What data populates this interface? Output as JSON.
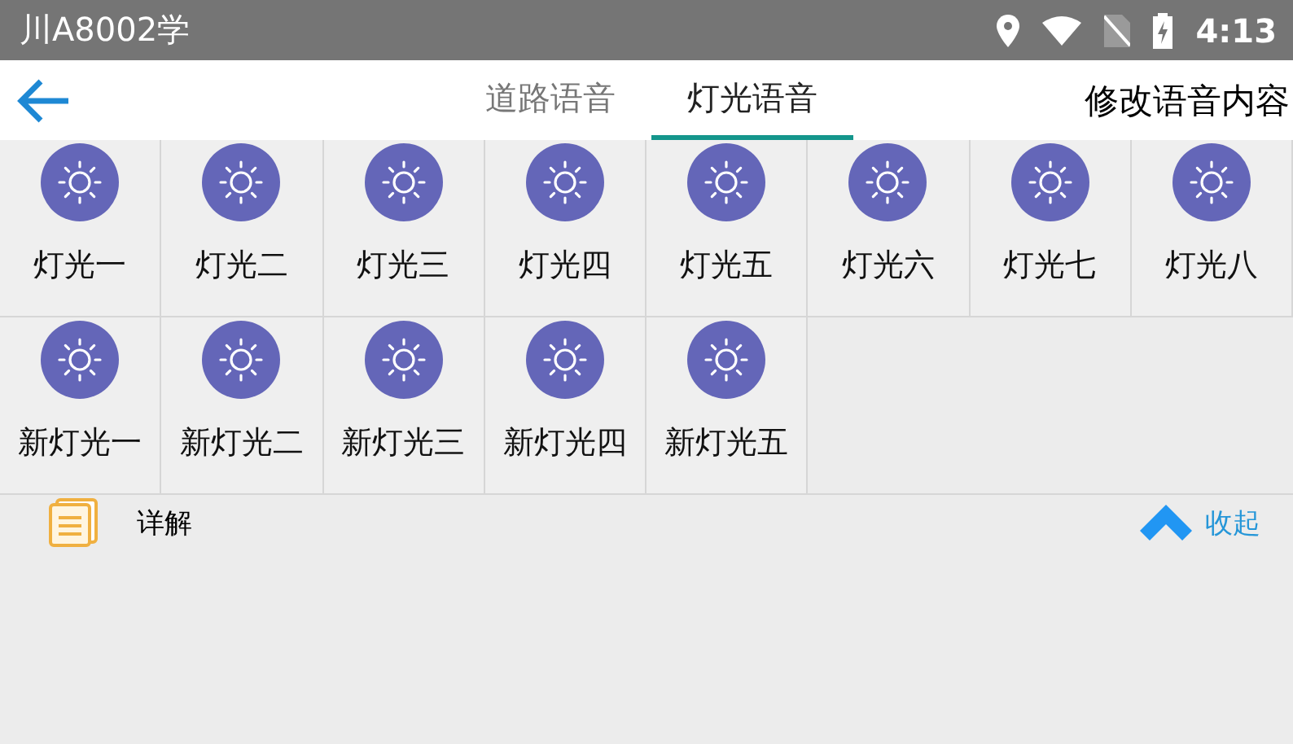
{
  "status_bar": {
    "title": "川A8002学",
    "time": "4:13"
  },
  "header": {
    "tabs": [
      {
        "label": "道路语音",
        "selected": false
      },
      {
        "label": "灯光语音",
        "selected": true
      }
    ],
    "action": "修改语音内容"
  },
  "grid": [
    {
      "label": "灯光一"
    },
    {
      "label": "灯光二"
    },
    {
      "label": "灯光三"
    },
    {
      "label": "灯光四"
    },
    {
      "label": "灯光五"
    },
    {
      "label": "灯光六"
    },
    {
      "label": "灯光七"
    },
    {
      "label": "灯光八"
    },
    {
      "label": "新灯光一"
    },
    {
      "label": "新灯光二"
    },
    {
      "label": "新灯光三"
    },
    {
      "label": "新灯光四"
    },
    {
      "label": "新灯光五"
    }
  ],
  "details": {
    "label": "详解",
    "toggle": "收起"
  }
}
